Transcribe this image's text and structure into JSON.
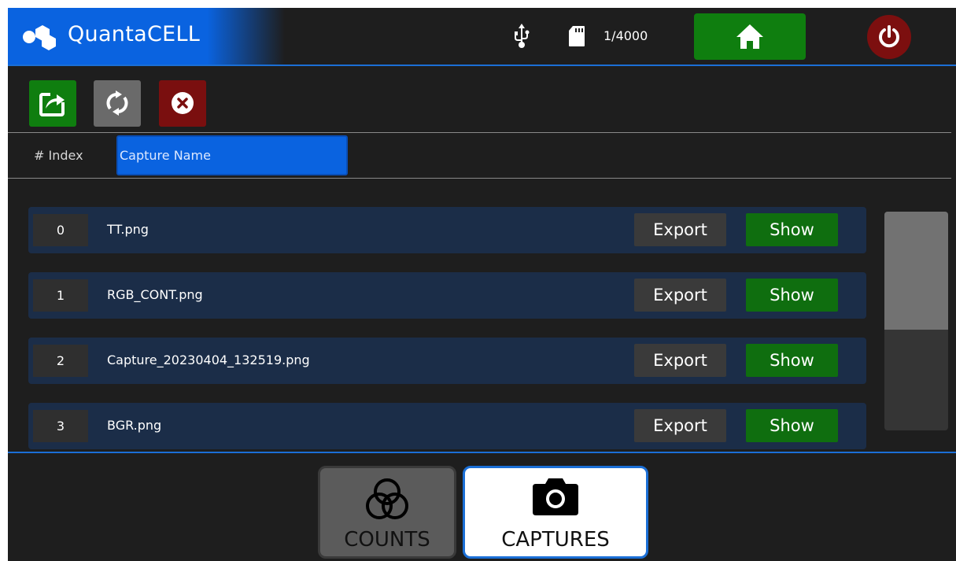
{
  "app": {
    "name": "QuantaCELL",
    "brand_color": "#0a63e0"
  },
  "status": {
    "usb_icon": "usb-icon",
    "sd_icon": "sd-card-icon",
    "counter": "1/4000"
  },
  "toolbar": {
    "export_icon": "share-export-icon",
    "refresh_icon": "refresh-icon",
    "delete_icon": "delete-icon"
  },
  "table": {
    "index_header": "# Index",
    "name_header": "Capture Name",
    "rows": [
      {
        "index": "0",
        "name": "TT.png",
        "export": "Export",
        "show": "Show"
      },
      {
        "index": "1",
        "name": "RGB_CONT.png",
        "export": "Export",
        "show": "Show"
      },
      {
        "index": "2",
        "name": "Capture_20230404_132519.png",
        "export": "Export",
        "show": "Show"
      },
      {
        "index": "3",
        "name": "BGR.png",
        "export": "Export",
        "show": "Show"
      }
    ]
  },
  "tabs": [
    {
      "label": "COUNTS",
      "icon": "overlapping-circles-icon",
      "active": false
    },
    {
      "label": "CAPTURES",
      "icon": "camera-icon",
      "active": true
    }
  ],
  "colors": {
    "accent_blue": "#1b6fd6",
    "green": "#0f7e0f",
    "red": "#7c0f0f",
    "row_bg": "#1b2d48"
  }
}
